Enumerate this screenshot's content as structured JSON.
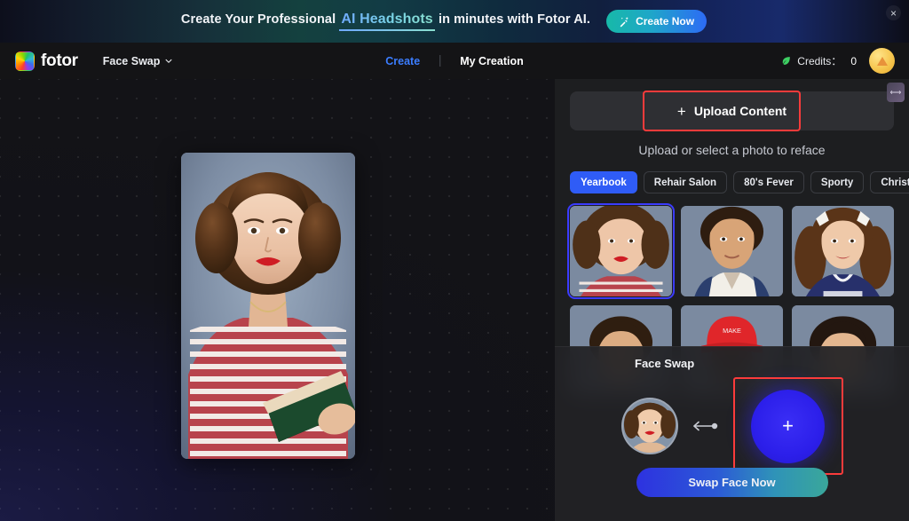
{
  "banner": {
    "text_before": "Create Your Professional ",
    "highlight": "AI Headshots",
    "text_after": " in minutes with Fotor AI.",
    "cta_label": "Create Now",
    "close_label": "×",
    "wand_icon": "magic-wand-icon",
    "gradient_from": "#17b9a8",
    "gradient_to": "#2d6bf5"
  },
  "nav": {
    "brand": "fotor",
    "logo_icon": "fotor-color-wheel-icon",
    "tool_name": "Face Swap",
    "tool_chevron": "chevron-down-icon",
    "links": [
      {
        "label": "Create",
        "active": true
      },
      {
        "label": "My Creation",
        "active": false
      }
    ],
    "credits_icon": "leaf-icon",
    "credits_label": "Credits：",
    "credits_value": "0",
    "avatar_icon": "user-avatar",
    "active_color": "#3b7dff"
  },
  "canvas": {
    "preview_alt": "yearbook-portrait-preview",
    "background_color": "#15161c"
  },
  "panel": {
    "upload_label": "Upload Content",
    "upload_plus": "+",
    "upload_highlight_color": "#fb3b3b",
    "collapse_icon": "collapse-panel-icon",
    "subtitle": "Upload or select a photo to reface",
    "categories": [
      {
        "label": "Yearbook",
        "active": true
      },
      {
        "label": "Rehair Salon",
        "active": false
      },
      {
        "label": "80's Fever",
        "active": false
      },
      {
        "label": "Sporty",
        "active": false
      },
      {
        "label": "Christmas",
        "active": false
      }
    ],
    "active_chip_color": "#2f5cf6",
    "templates": [
      {
        "name": "yearbook-woman-striped-top",
        "selected": true
      },
      {
        "name": "yearbook-young-man-white-shirt",
        "selected": false
      },
      {
        "name": "yearbook-cheerleader",
        "selected": false
      },
      {
        "name": "yearbook-man-row2",
        "selected": false
      },
      {
        "name": "yearbook-red-cap",
        "selected": false
      },
      {
        "name": "yearbook-woman-row2",
        "selected": false
      }
    ]
  },
  "swap": {
    "title": "Face Swap",
    "source_face": "selected-source-face",
    "arrow_icon": "arrow-left-connector-icon",
    "target_plus": "+",
    "target_highlight_color": "#fb3b3b",
    "cta_label": "Swap Face Now"
  }
}
